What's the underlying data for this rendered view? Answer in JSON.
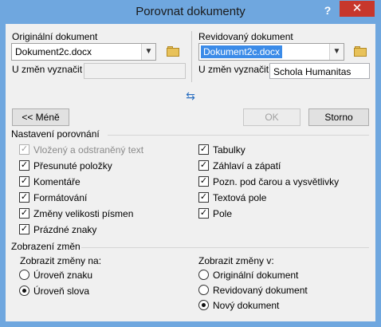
{
  "window": {
    "title": "Porovnat dokumenty",
    "help_label": "?",
    "close_label": "✕"
  },
  "original": {
    "label": "Originální dokument",
    "document": "Dokument2c.docx",
    "author_label": "U změn vyznačit",
    "author_value": ""
  },
  "revised": {
    "label": "Revidovaný dokument",
    "document": "Dokument2c.docx",
    "author_label": "U změn vyznačit",
    "author_value": "Schola Humanitas"
  },
  "buttons": {
    "less": "<< Méně",
    "ok": "OK",
    "cancel": "Storno"
  },
  "comparison_settings": {
    "title": "Nastavení porovnání",
    "left": [
      {
        "label": "Vložený a odstraněný text",
        "checked": true,
        "disabled": true
      },
      {
        "label": "Přesunuté položky",
        "checked": true,
        "disabled": false
      },
      {
        "label": "Komentáře",
        "checked": true,
        "disabled": false
      },
      {
        "label": "Formátování",
        "checked": true,
        "disabled": false
      },
      {
        "label": "Změny velikosti písmen",
        "checked": true,
        "disabled": false
      },
      {
        "label": "Prázdné znaky",
        "checked": true,
        "disabled": false
      }
    ],
    "right": [
      {
        "label": "Tabulky",
        "checked": true,
        "disabled": false
      },
      {
        "label": "Záhlaví a zápatí",
        "checked": true,
        "disabled": false
      },
      {
        "label": "Pozn. pod čarou a vysvětlivky",
        "checked": true,
        "disabled": false
      },
      {
        "label": "Textová pole",
        "checked": true,
        "disabled": false
      },
      {
        "label": "Pole",
        "checked": true,
        "disabled": false
      }
    ]
  },
  "show_changes": {
    "title": "Zobrazení změn",
    "level": {
      "label": "Zobrazit změny na:",
      "options": [
        {
          "label": "Úroveň znaku",
          "selected": false
        },
        {
          "label": "Úroveň slova",
          "selected": true
        }
      ]
    },
    "target": {
      "label": "Zobrazit změny v:",
      "options": [
        {
          "label": "Originální dokument",
          "selected": false
        },
        {
          "label": "Revidovaný dokument",
          "selected": false
        },
        {
          "label": "Nový dokument",
          "selected": true
        }
      ]
    }
  }
}
